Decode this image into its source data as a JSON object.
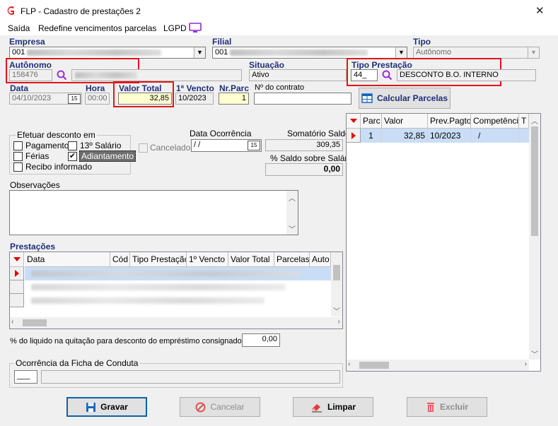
{
  "window": {
    "title": "FLP - Cadastro de prestações 2",
    "close": "✕"
  },
  "menu": {
    "saida": "Saída",
    "redefine": "Redefine vencimentos parcelas",
    "lgpd": "LGPD"
  },
  "empresa": {
    "label": "Empresa",
    "value": "001"
  },
  "filial": {
    "label": "Filial",
    "value": "001"
  },
  "tipo": {
    "label": "Tipo",
    "value": "Autônomo"
  },
  "autonomo": {
    "label": "Autônomo",
    "code": "158476"
  },
  "situacao": {
    "label": "Situação",
    "value": "Ativo"
  },
  "tipo_prestacao": {
    "label": "Tipo Prestação",
    "code": "44_",
    "value": "DESCONTO B.O. INTERNO"
  },
  "data": {
    "label": "Data",
    "value": "04/10/2023"
  },
  "hora": {
    "label": "Hora",
    "value": "00:00"
  },
  "valor_total": {
    "label": "Valor Total",
    "value": "32,85"
  },
  "primeiro_vencto": {
    "label": "1ª Vencto",
    "value": "10/2023"
  },
  "nr_parc": {
    "label": "Nr.Parc",
    "value": "1"
  },
  "nr_contrato": {
    "label": "Nº do contrato",
    "value": ""
  },
  "calcular_label": "Calcular Parcelas",
  "efetuar": {
    "title": "Efetuar desconto em",
    "pagamento": "Pagamento",
    "decimo": "13º Salário",
    "ferias": "Férias",
    "adiantamento": "Adiantamento",
    "recibo": "Recibo informado",
    "checked_adiantamento": "✔"
  },
  "cancelado_label": "Cancelado",
  "data_ocorrencia": {
    "label": "Data Ocorrência",
    "value": " / /"
  },
  "somatorio": {
    "label": "Somatório Saldo",
    "value": "309,35"
  },
  "saldo_salario": {
    "label": "% Saldo sobre Salário",
    "value": "0,00"
  },
  "observacoes_label": "Observações",
  "prestacoes": {
    "label": "Prestações",
    "columns": [
      "Data",
      "Cód",
      "Tipo Prestação",
      "1º Vencto",
      "Valor Total",
      "Parcelas",
      "Auto"
    ]
  },
  "parcelas_grid": {
    "columns": [
      "Parc",
      "Valor",
      "Prev.Pagto",
      "Competência",
      "T"
    ],
    "rows": [
      {
        "parc": "1",
        "valor": "32,85",
        "prev": "10/2023",
        "comp": "/"
      }
    ]
  },
  "consignado": {
    "label": "% do liquido na quitação para desconto do empréstimo consignado",
    "value": "0,00"
  },
  "ficha": {
    "label": "Ocorrência da Ficha de Conduta",
    "code": "___"
  },
  "buttons": {
    "gravar": "Gravar",
    "cancelar": "Cancelar",
    "limpar": "Limpar",
    "excluir": "Excluir"
  },
  "colors": {
    "highlight_box": "#e0161b",
    "accent_blue": "#1f2f7a",
    "selected_row": "#c9ddf6"
  }
}
